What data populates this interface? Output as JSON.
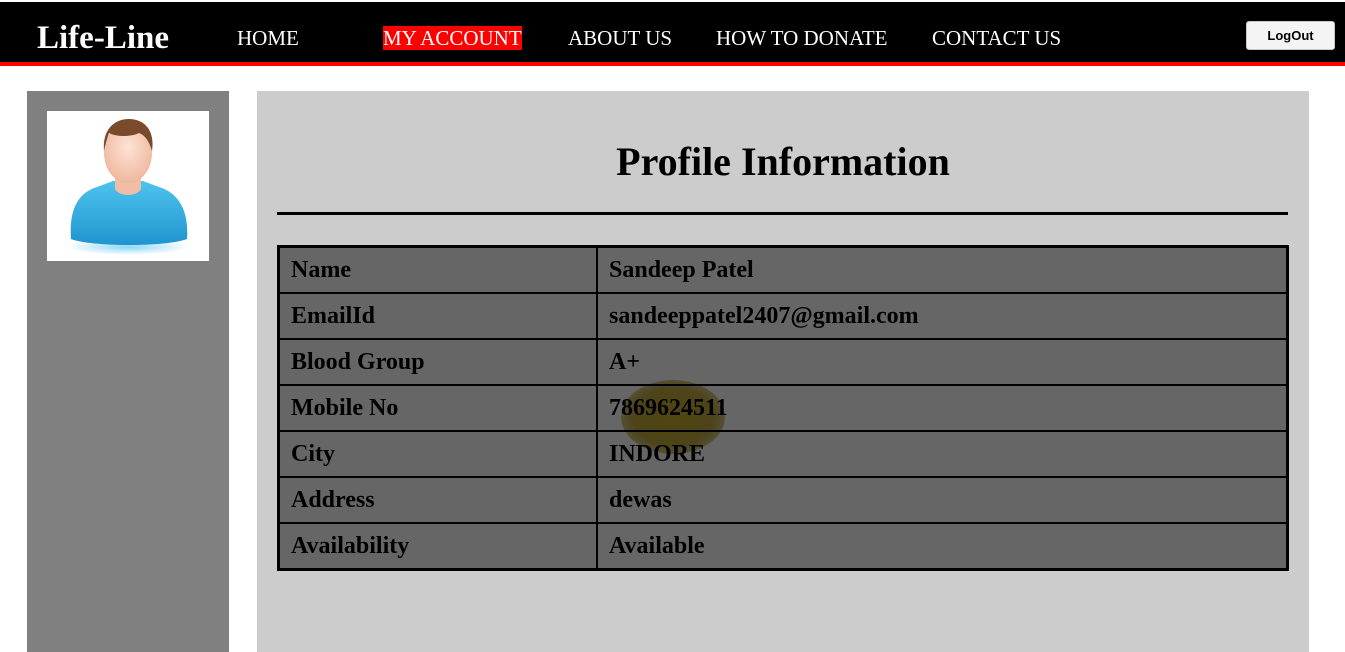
{
  "header": {
    "brand": "Life-Line",
    "nav": [
      {
        "label": "HOME",
        "active": false
      },
      {
        "label": "MY ACCOUNT",
        "active": true
      },
      {
        "label": "ABOUT US",
        "active": false
      },
      {
        "label": "HOW TO DONATE",
        "active": false
      },
      {
        "label": "CONTACT US",
        "active": false
      }
    ],
    "logout_label": "LogOut"
  },
  "sidebar": {
    "avatar_icon": "user-avatar-icon"
  },
  "main": {
    "title": "Profile Information",
    "rows": [
      {
        "label": "Name",
        "value": "Sandeep Patel"
      },
      {
        "label": "EmailId",
        "value": "sandeeppatel2407@gmail.com"
      },
      {
        "label": "Blood Group",
        "value": "A+"
      },
      {
        "label": "Mobile No",
        "value": "7869624511"
      },
      {
        "label": "City",
        "value": "INDORE"
      },
      {
        "label": "Address",
        "value": "dewas"
      },
      {
        "label": "Availability",
        "value": "Available"
      }
    ]
  },
  "colors": {
    "navbar_bg": "#000000",
    "accent": "#ff0000",
    "sidebar_bg": "#808080",
    "panel_bg": "#cccccc",
    "table_bg": "#666666"
  }
}
